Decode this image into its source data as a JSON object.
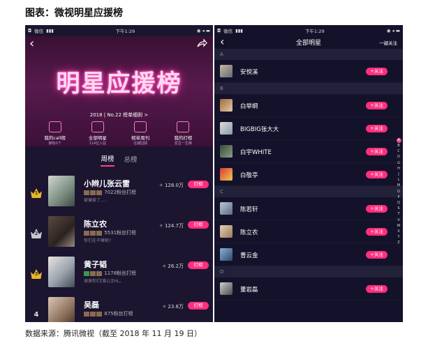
{
  "figure": {
    "title": "图表：微视明星应援榜",
    "source": "数据来源：腾讯微视（截至 2018 年 11 月 19 日）"
  },
  "left_screen": {
    "status": {
      "carrier": "微信",
      "time": "下午1:29"
    },
    "hero": {
      "title": "明星应援榜",
      "issue": "2018 | No.22 榜单细则 >",
      "nav": [
        {
          "label": "我的call榜",
          "sub": "拥有0个"
        },
        {
          "label": "全部明星",
          "sub": "114位入驻"
        },
        {
          "label": "榜单周刊",
          "sub": "往期回顾"
        },
        {
          "label": "我的打榜",
          "sub": "爱豆一生推"
        }
      ]
    },
    "tabs": [
      "周榜",
      "总榜"
    ],
    "ranking": [
      {
        "rank": "1",
        "name": "小辫儿张云雷",
        "fans": "7022粉丝打榜",
        "msg": "被偏爱了.....",
        "score": "128.0万",
        "button": "打榜",
        "crown": "gold"
      },
      {
        "rank": "2",
        "name": "陈立农",
        "fans": "5531粉丝打榜",
        "msg": "你们在干嘛呢?",
        "score": "124.7万",
        "button": "打榜",
        "crown": "silver"
      },
      {
        "rank": "3",
        "name": "黄子韬",
        "fans": "1178粉丝打榜",
        "msg": "谢谢你们[爱心][HL。",
        "score": "26.2万",
        "button": "打榜",
        "crown": "gold"
      },
      {
        "rank": "4",
        "name": "吴磊",
        "fans": "875粉丝打榜",
        "msg": "",
        "score": "23.8万",
        "button": "打榜",
        "crown": "none"
      }
    ]
  },
  "right_screen": {
    "status": {
      "carrier": "微信",
      "time": "下午1:29"
    },
    "header": {
      "title": "全部明星",
      "action": "一键关注"
    },
    "sections": [
      {
        "letter": "A",
        "stars": [
          {
            "name": "安悦溪",
            "button": "+关注"
          }
        ]
      },
      {
        "letter": "B",
        "stars": [
          {
            "name": "白举纲",
            "button": "+关注"
          },
          {
            "name": "BIGBIG张大大",
            "button": "+关注"
          },
          {
            "name": "白宇WHITE",
            "button": "+关注"
          },
          {
            "name": "白敬亭",
            "button": "+关注"
          }
        ]
      },
      {
        "letter": "C",
        "stars": [
          {
            "name": "陈若轩",
            "button": "+关注"
          },
          {
            "name": "陈立农",
            "button": "+关注"
          },
          {
            "name": "曹云金",
            "button": "+关注"
          }
        ]
      },
      {
        "letter": "D",
        "stars": [
          {
            "name": "董岩磊",
            "button": "+关注"
          }
        ]
      }
    ],
    "alphabet": [
      "A",
      "B",
      "C",
      "D",
      "G",
      "H",
      "J",
      "L",
      "M",
      "O",
      "P",
      "Q",
      "S",
      "T",
      "V",
      "W",
      "X",
      "Y",
      "Z"
    ]
  },
  "colors": {
    "accent": "#ff2f7d",
    "bg_dark": "#13122a"
  }
}
